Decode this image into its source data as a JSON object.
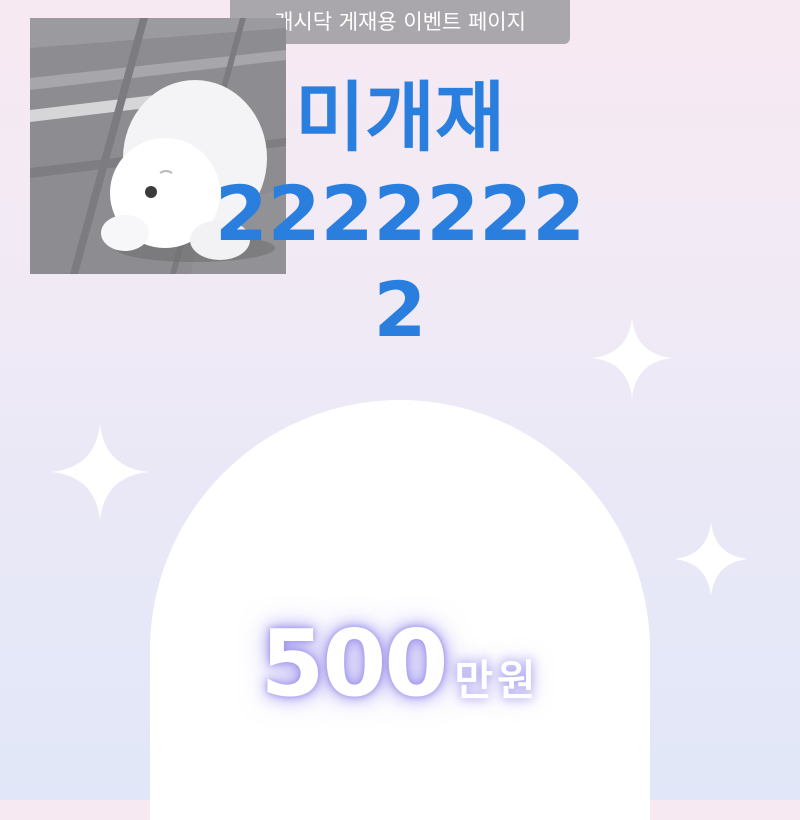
{
  "header": {
    "label": "캐시닥 게재용 이벤트 페이지"
  },
  "thumbnail": {
    "icon": "puppy-photo"
  },
  "headline": {
    "line1": "미개재",
    "line2": "2222222",
    "line3": "2"
  },
  "prize": {
    "amount": "500",
    "unit": "만원"
  },
  "colors": {
    "headline": "#2a7fde",
    "header_bg": "#a9a7ac",
    "glow": "#a79cf0",
    "arch": "#ffffff"
  }
}
